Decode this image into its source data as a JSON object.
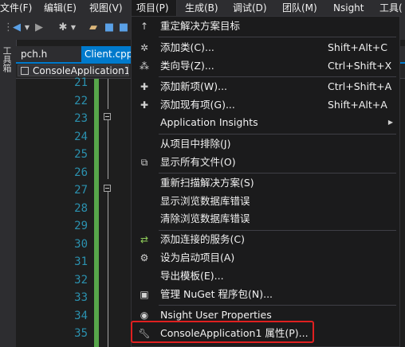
{
  "menubar": {
    "items": [
      "文件(F)",
      "编辑(E)",
      "视图(V)",
      "项目(P)",
      "生成(B)",
      "调试(D)",
      "团队(M)",
      "Nsight",
      "工具("
    ]
  },
  "toolbar": {
    "back_icon": "back-arrow-icon",
    "forward_icon": "forward-arrow-icon"
  },
  "left_strip": {
    "label": "工具箱"
  },
  "tabs": [
    {
      "label": "pch.h"
    },
    {
      "label": "Client.cpp"
    }
  ],
  "navbar": {
    "project": "ConsoleApplication1"
  },
  "editor": {
    "line_numbers": [
      "21",
      "22",
      "23",
      "24",
      "25",
      "26",
      "27",
      "28",
      "29",
      "30",
      "31",
      "32",
      "33",
      "34",
      "35"
    ]
  },
  "context_menu": {
    "items": [
      {
        "icon": "arrow-up-icon",
        "label": "重定解决方案目标",
        "shortcut": ""
      },
      {
        "icon": "add-class-icon",
        "label": "添加类(C)...",
        "shortcut": "Shift+Alt+C"
      },
      {
        "icon": "class-wizard-icon",
        "label": "类向导(Z)...",
        "shortcut": "Ctrl+Shift+X"
      },
      {
        "icon": "add-new-item-icon",
        "label": "添加新项(W)...",
        "shortcut": "Ctrl+Shift+A"
      },
      {
        "icon": "add-existing-item-icon",
        "label": "添加现有项(G)...",
        "shortcut": "Shift+Alt+A"
      },
      {
        "icon": "",
        "label": "Application Insights",
        "shortcut": "",
        "submenu": true
      },
      {
        "icon": "",
        "label": "从项目中排除(J)",
        "shortcut": ""
      },
      {
        "icon": "show-all-files-icon",
        "label": "显示所有文件(O)",
        "shortcut": ""
      },
      {
        "icon": "",
        "label": "重新扫描解决方案(S)",
        "shortcut": ""
      },
      {
        "icon": "",
        "label": "显示浏览数据库错误",
        "shortcut": ""
      },
      {
        "icon": "",
        "label": "清除浏览数据库错误",
        "shortcut": ""
      },
      {
        "icon": "connected-service-icon",
        "label": "添加连接的服务(C)",
        "shortcut": ""
      },
      {
        "icon": "gear-icon",
        "label": "设为启动项目(A)",
        "shortcut": ""
      },
      {
        "icon": "",
        "label": "导出模板(E)...",
        "shortcut": ""
      },
      {
        "icon": "nuget-icon",
        "label": "管理 NuGet 程序包(N)...",
        "shortcut": ""
      },
      {
        "icon": "globe-icon",
        "label": "Nsight User Properties",
        "shortcut": ""
      },
      {
        "icon": "wrench-icon",
        "label": "ConsoleApplication1 属性(P)...",
        "shortcut": ""
      }
    ]
  },
  "colors": {
    "accent": "#007acc",
    "highlight": "#e02020",
    "change_bar": "#57a64a",
    "line_number": "#2b91af"
  }
}
